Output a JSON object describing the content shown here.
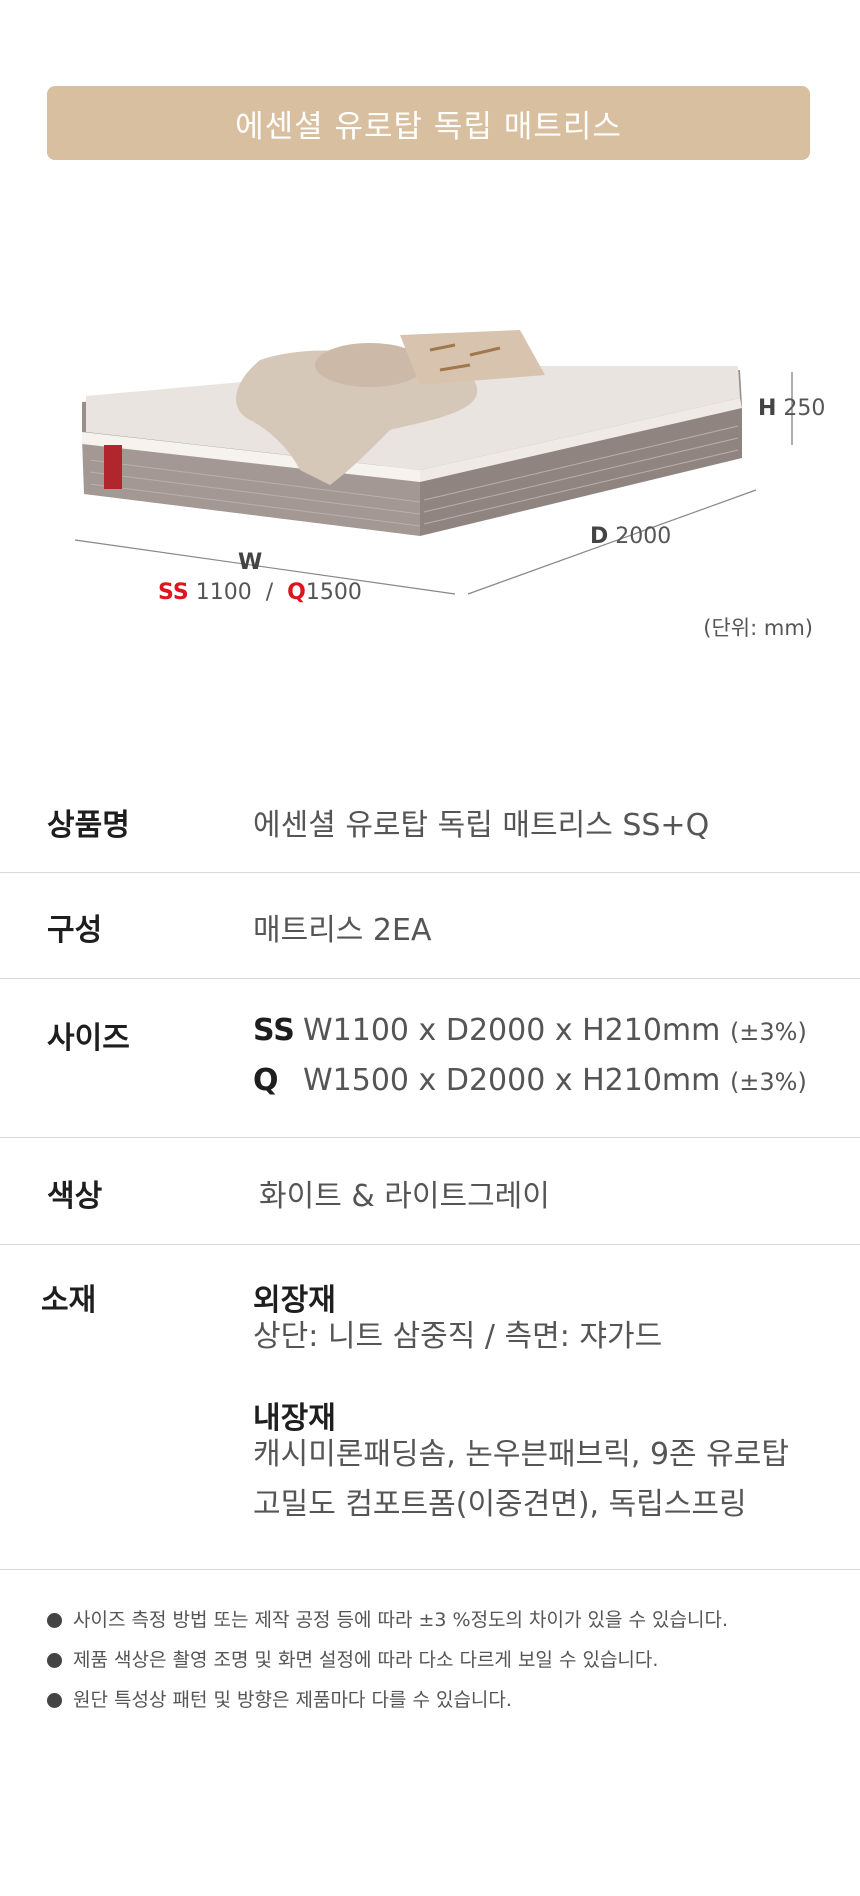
{
  "product_title": "에센셜 유로탑 독립 매트리스",
  "figure": {
    "height_label": "H",
    "height_value": "250",
    "depth_label": "D",
    "depth_value": "2000",
    "width_label": "W",
    "ss_label": "SS",
    "ss_value": "1100",
    "separator": "/",
    "q_label": "Q",
    "q_value": "1500",
    "unit": "(단위: mm)"
  },
  "specs": {
    "name": {
      "label": "상품명",
      "value": "에센셜 유로탑 독립 매트리스 SS+Q"
    },
    "composition": {
      "label": "구성",
      "value": "매트리스 2EA"
    },
    "size": {
      "label": "사이즈",
      "lines": [
        {
          "code": "SS",
          "dims": "W1100 x D2000 x H210mm",
          "tolerance": "(±3%)"
        },
        {
          "code": "Q",
          "dims": "W1500 x D2000 x H210mm",
          "tolerance": "(±3%)"
        }
      ]
    },
    "color": {
      "label": "색상",
      "value": "화이트 & 라이트그레이"
    },
    "material": {
      "label": "소재",
      "outer_head": "외장재",
      "outer_value": "상단: 니트 삼중직  /  측면: 쟈가드",
      "inner_head": "내장재",
      "inner_line1": "캐시미론패딩솜, 논우븐패브릭, 9존 유로탑",
      "inner_line2": "고밀도 컴포트폼(이중견면), 독립스프링"
    }
  },
  "notes": [
    "사이즈 측정 방법 또는 제작 공정 등에 따라 ±3 %정도의 차이가 있을 수 있습니다.",
    "제품 색상은 촬영 조명 및 화면 설정에 따라 다소 다르게 보일 수 있습니다.",
    "원단 특성상 패턴 및 방향은 제품마다 다를 수 있습니다."
  ]
}
